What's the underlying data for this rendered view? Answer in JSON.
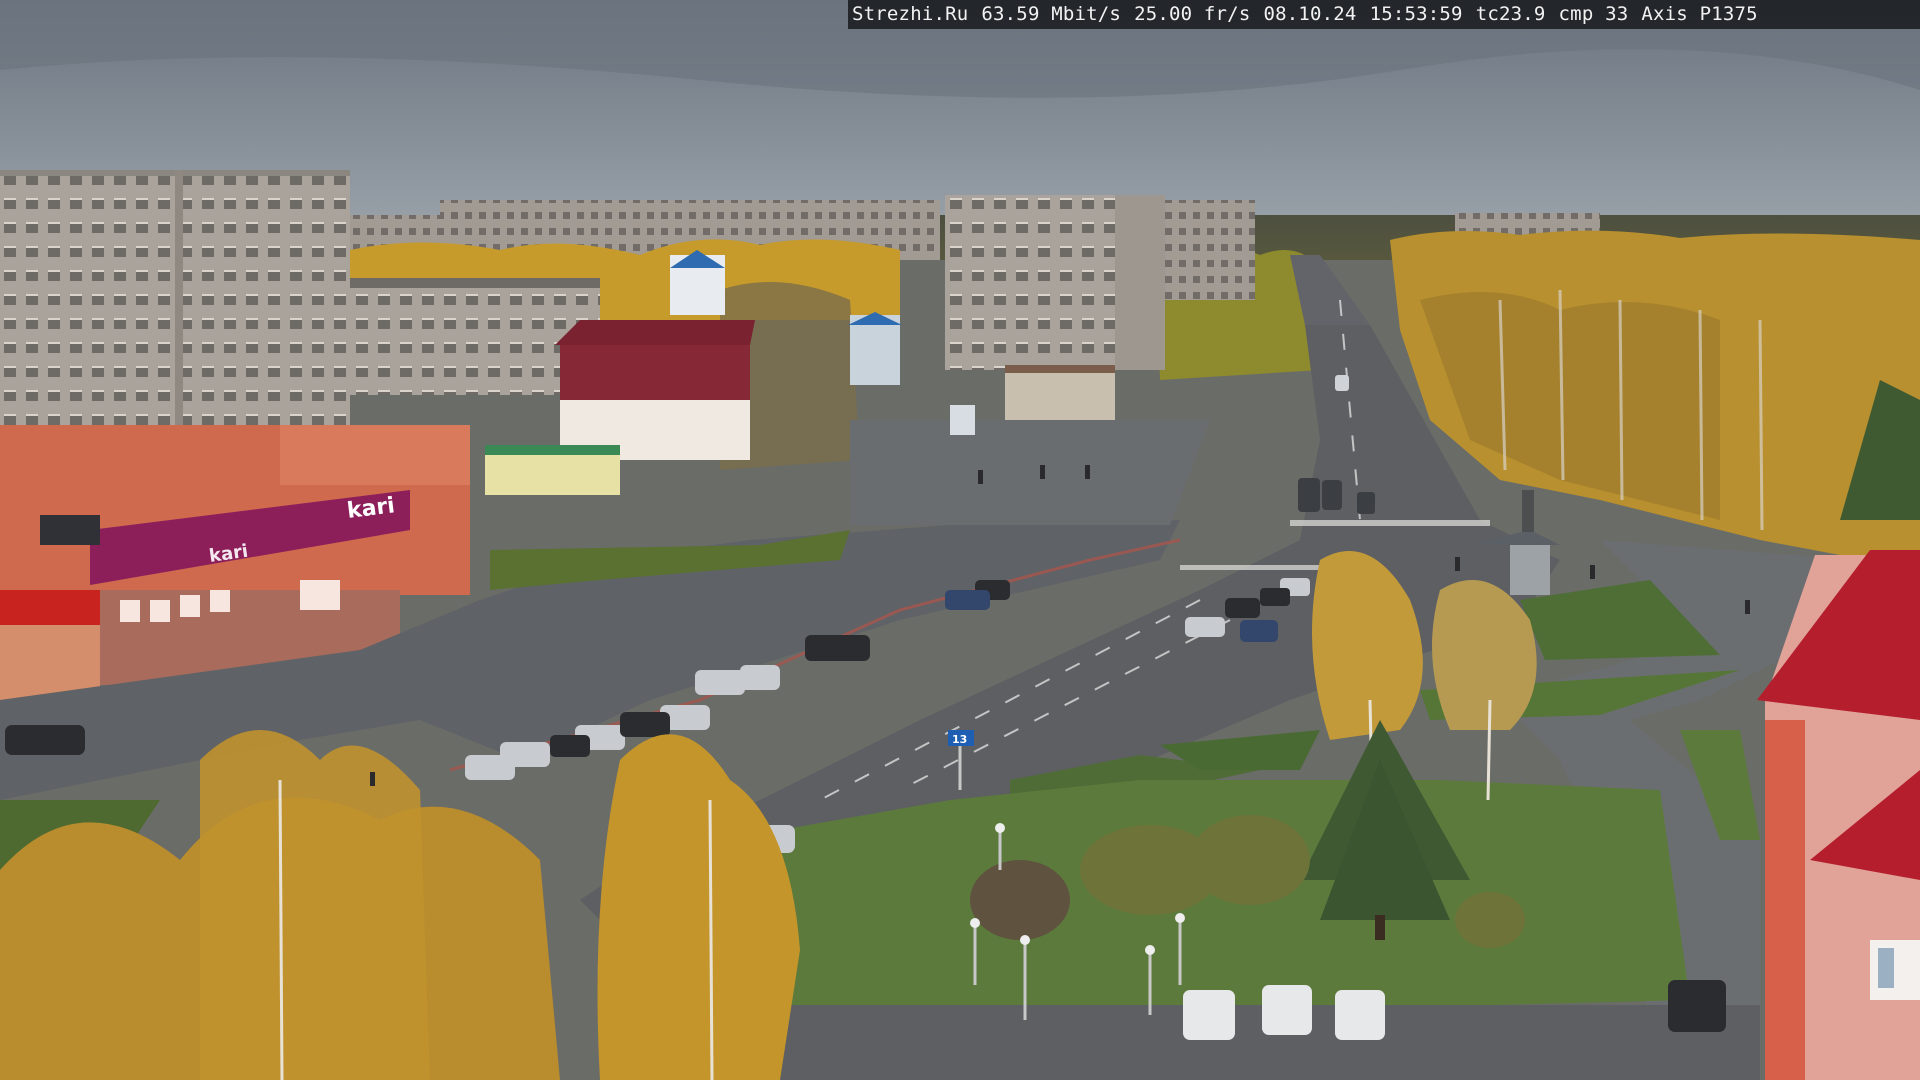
{
  "overlay": {
    "site": "Strezhi.Ru",
    "bitrate": "63.59 Mbit/s",
    "framerate": "25.00 fr/s",
    "date": "08.10.24",
    "time": "15:53:59",
    "tc": "tc23.9",
    "cmp": "cmp 33",
    "camera": "Axis P1375"
  },
  "signage": {
    "store_logo": "kari",
    "store_banner": "kari",
    "road_sign": "13"
  },
  "colors": {
    "sky": "#7d8791",
    "road": "#5f6266",
    "grass": "#5c7a3c",
    "autumn_foliage": "#c99a2a",
    "building_panel": "#a8a098",
    "store_facade": "#d0553e",
    "store_banner": "#8c1f5a",
    "tower_roof": "#b41e2d"
  }
}
